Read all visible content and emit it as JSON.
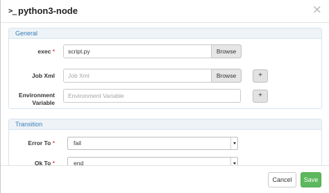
{
  "dialog": {
    "icon": "terminal-icon",
    "title": "python3-node",
    "close_glyph": "×"
  },
  "general": {
    "title": "General",
    "exec": {
      "label": "exec",
      "required": "*",
      "value": "script.py",
      "browse": "Browse"
    },
    "job_xml": {
      "label": "Job Xml",
      "placeholder": "Job Xml",
      "browse": "Browse",
      "add": "+"
    },
    "env": {
      "label_line1": "Environment",
      "label_line2": "Variable",
      "placeholder": "Environment Variable",
      "add": "+"
    }
  },
  "transition": {
    "title": "Transition",
    "error_to": {
      "label": "Error To",
      "required": "*",
      "value": "fail"
    },
    "ok_to": {
      "label": "Ok To",
      "required": "*",
      "value": "end"
    }
  },
  "footer": {
    "cancel": "Cancel",
    "save": "Save"
  },
  "colors": {
    "panel_header_text": "#3b7fb8",
    "panel_header_bg": "#eef3f8",
    "required": "#d9534f",
    "save_button": "#5cb85c"
  }
}
